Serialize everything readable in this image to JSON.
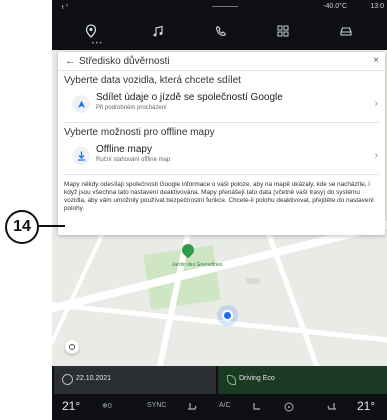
{
  "status": {
    "signal": "ᵻ ⁱⁱ",
    "outside_temp": "-40.0°C",
    "clock": "13:0"
  },
  "nav": {
    "icons": [
      "location-pin-icon",
      "music-icon",
      "phone-icon",
      "apps-icon",
      "car-icon"
    ],
    "dots": "• • •"
  },
  "map": {
    "park_label": "Jardin des Grenadines"
  },
  "dialog": {
    "back_icon": "←",
    "title": "Středisko důvěrnosti",
    "close_icon": "×",
    "section1": "Vyberte data vozidla, která chcete sdílet",
    "item1_title": "Sdílet údaje o jízdě se společností Google",
    "item1_subtitle": "Při podrobném procházení",
    "section2": "Vyberte možnosti pro offline mapy",
    "item2_title": "Offline mapy",
    "item2_subtitle": "Ruční stahování offline map",
    "chevron": "›",
    "note": "Mapy někdy odesílají společnosti Google informace o vaší poloze, aby na mapě ukázaly, kde se nacházíte, i když jsou všechna tato nastavení deaktivována. Mapy přenášejí tato data (včetně vaší trasy) do systému vozidla, aby vám umožnily používat bezpečnostní funkce. Chcete-li polohu deaktivovat, přejděte do nastavení polohy."
  },
  "callout": {
    "number": "14"
  },
  "bottom": {
    "date": "22.10.2021",
    "drive_mode": "Driving Eco"
  },
  "climate": {
    "left_temp": "21°",
    "fan": "❄0",
    "sync": "SYNC",
    "ac": "A/C",
    "right_temp": "21°"
  },
  "colors": {
    "accent_blue": "#1a73e8",
    "eco_green": "#1b3a24",
    "screen_bg": "#0d0f12"
  }
}
